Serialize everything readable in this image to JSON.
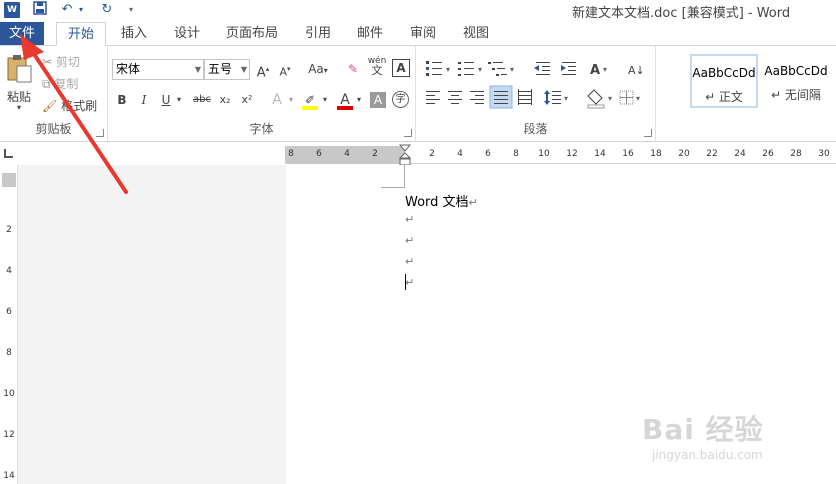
{
  "titlebar": {
    "app_icon": "W",
    "qat_icons": [
      "save-icon",
      "undo-icon",
      "undo-dropdown-icon",
      "redo-icon",
      "customize-qat-icon"
    ],
    "document_title": "新建文本文档.doc [兼容模式] - Word"
  },
  "tabs": {
    "file": "文件",
    "items": [
      "开始",
      "插入",
      "设计",
      "页面布局",
      "引用",
      "邮件",
      "审阅",
      "视图"
    ]
  },
  "ribbon": {
    "clipboard": {
      "paste": "粘贴",
      "cut": "剪切",
      "copy": "复制",
      "format_painter": "格式刷",
      "label": "剪贴板"
    },
    "font": {
      "font_name": "宋体",
      "font_size": "五号",
      "case_button": "Aa",
      "phonetic_top": "wén",
      "phonetic_bottom": "文",
      "border_char": "A",
      "bold": "B",
      "italic": "I",
      "underline": "U",
      "strikethrough": "abc",
      "subscript": "x₂",
      "superscript": "x²",
      "text_effects": "A",
      "font_color": "A",
      "char_shading": "A",
      "enclose_char": "字",
      "label": "字体",
      "highlight_color": "#ffff00",
      "font_color_value": "#e00000"
    },
    "paragraph": {
      "label": "段落"
    },
    "styles": {
      "items": [
        {
          "sample": "AaBbCcDd",
          "name": "↵ 正文"
        },
        {
          "sample": "AaBbCcDd",
          "name": "↵ 无间隔"
        }
      ]
    }
  },
  "ruler": {
    "horizontal_ticks": [
      "8",
      "6",
      "4",
      "2",
      "2",
      "4",
      "6",
      "8",
      "10",
      "12",
      "14",
      "16",
      "18",
      "20",
      "22",
      "24",
      "26",
      "28",
      "30"
    ],
    "vertical_ticks": [
      "2",
      "4",
      "6",
      "8",
      "10",
      "12",
      "14"
    ],
    "corner_icon": "tab-stop-icon"
  },
  "document": {
    "lines": [
      "Word 文档",
      "",
      "",
      "",
      ""
    ],
    "paragraph_mark": "↵"
  },
  "watermark": {
    "brand": "Bai 经验",
    "url": "jingyan.baidu.com"
  },
  "annotation": {
    "arrow_color": "#e8392f"
  }
}
